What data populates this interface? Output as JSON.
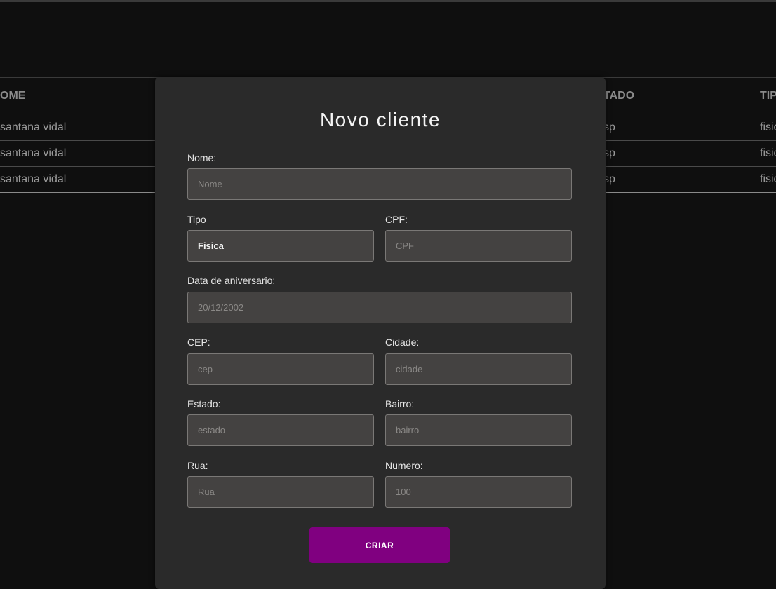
{
  "background_table": {
    "headers": [
      "OME",
      "TADO",
      "TIP"
    ],
    "rows": [
      {
        "nome": "santana vidal",
        "estado": "sp",
        "tipo": "fisic"
      },
      {
        "nome": "santana vidal",
        "estado": "sp",
        "tipo": "fisic"
      },
      {
        "nome": "santana vidal",
        "estado": "sp",
        "tipo": "fisic"
      }
    ]
  },
  "modal": {
    "title": "Novo cliente",
    "nome": {
      "label": "Nome:",
      "placeholder": "Nome"
    },
    "tipo": {
      "label": "Tipo",
      "value": "Fisica"
    },
    "cpf": {
      "label": "CPF:",
      "placeholder": "CPF"
    },
    "data": {
      "label": "Data de aniversario:",
      "placeholder": "20/12/2002"
    },
    "cep": {
      "label": "CEP:",
      "placeholder": "cep"
    },
    "cidade": {
      "label": "Cidade:",
      "placeholder": "cidade"
    },
    "estado": {
      "label": "Estado:",
      "placeholder": "estado"
    },
    "bairro": {
      "label": "Bairro:",
      "placeholder": "bairro"
    },
    "rua": {
      "label": "Rua:",
      "placeholder": "Rua"
    },
    "numero": {
      "label": "Numero:",
      "placeholder": "100"
    },
    "submit_label": "CRIAR"
  },
  "colors": {
    "page_bg": "#0f0f0f",
    "modal_bg": "#2a2a2a",
    "field_bg": "#444241",
    "accent": "#800080"
  }
}
